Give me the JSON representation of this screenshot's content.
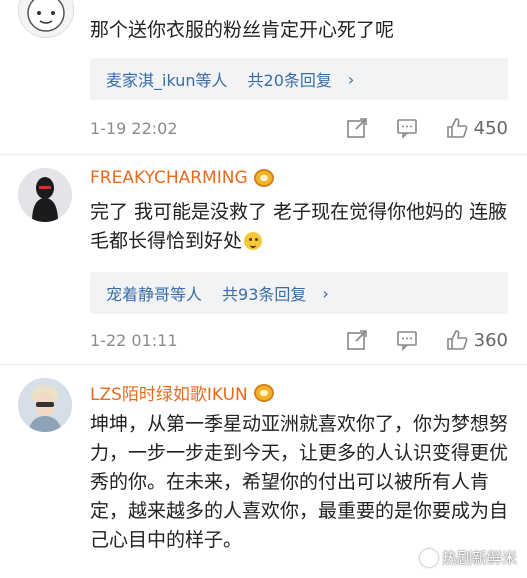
{
  "comments": [
    {
      "username": "",
      "text": "那个送你衣服的粉丝肯定开心死了呢",
      "replies": {
        "users": "麦家淇_ikun",
        "suffix": "等人",
        "count": "共20条回复"
      },
      "time": "1-19 22:02",
      "likes": "450"
    },
    {
      "username": "FREAKYCHARMING",
      "text": "完了 我可能是没救了 老子现在觉得你他妈的 连腋毛都长得恰到好处",
      "replies": {
        "users": "宠着静哥",
        "suffix": "等人",
        "count": "共93条回复"
      },
      "time": "1-22 01:11",
      "likes": "360"
    },
    {
      "username": "LZS陌时绿如歌IKUN",
      "text": "坤坤，从第一季星动亚洲就喜欢你了，你为梦想努力，一步一步走到今天，让更多的人认识变得更优秀的你。在未来，希望你的付出可以被所有人肯定，越来越多的人喜欢你，最重要的是你要成为自己心目中的样子。"
    }
  ],
  "watermark": "热剧新鲜米",
  "colors": {
    "username": "#e86b1f",
    "link": "#3a6da6",
    "reply_bg": "#f2f3f5",
    "meta": "#8c8c8c"
  },
  "icons": [
    "share-icon",
    "comment-icon",
    "like-icon",
    "vip-crown-icon",
    "emoji-icon"
  ]
}
